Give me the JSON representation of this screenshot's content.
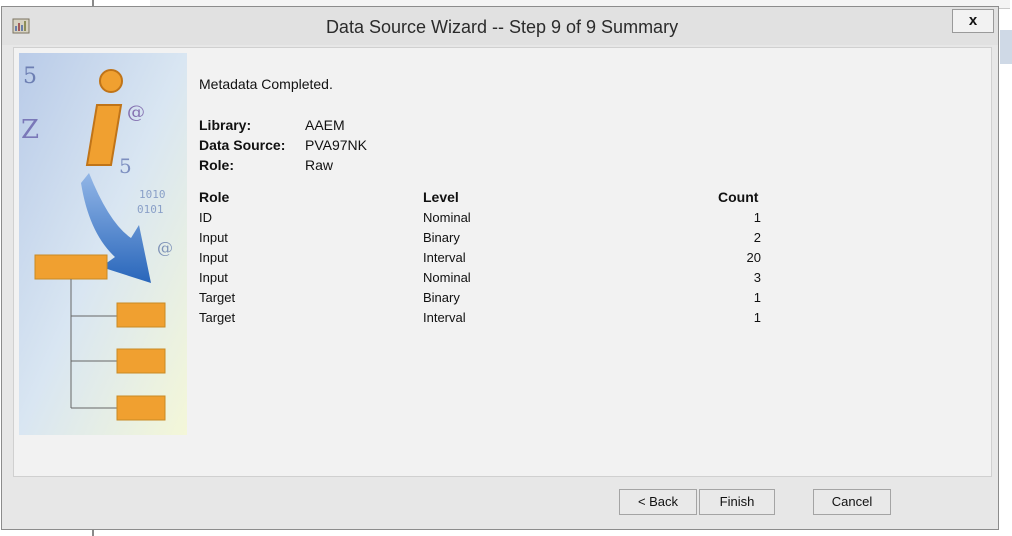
{
  "window": {
    "title": "Data Source Wizard  -- Step 9 of 9  Summary",
    "close_label": "x"
  },
  "summary": {
    "status": "Metadata Completed.",
    "library_label": "Library:",
    "library_value": "AAEM",
    "datasource_label": "Data Source:",
    "datasource_value": "PVA97NK",
    "role_label": "Role:",
    "role_value": "Raw"
  },
  "table": {
    "headers": [
      "Role",
      "Level",
      "Count"
    ],
    "rows": [
      {
        "role": "ID",
        "level": "Nominal",
        "count": "1"
      },
      {
        "role": "Input",
        "level": "Binary",
        "count": "2"
      },
      {
        "role": "Input",
        "level": "Interval",
        "count": "20"
      },
      {
        "role": "Input",
        "level": "Nominal",
        "count": "3"
      },
      {
        "role": "Target",
        "level": "Binary",
        "count": "1"
      },
      {
        "role": "Target",
        "level": "Interval",
        "count": "1"
      }
    ]
  },
  "buttons": {
    "back": "< Back",
    "finish": "Finish",
    "cancel": "Cancel"
  },
  "icons": {
    "app": "wizard-app-icon",
    "close": "close-icon",
    "illustration": "info-illustration"
  },
  "colors": {
    "accent_orange": "#f0a030",
    "arrow_blue": "#1f5fb8",
    "dialog_bg": "#e7e7e7"
  }
}
